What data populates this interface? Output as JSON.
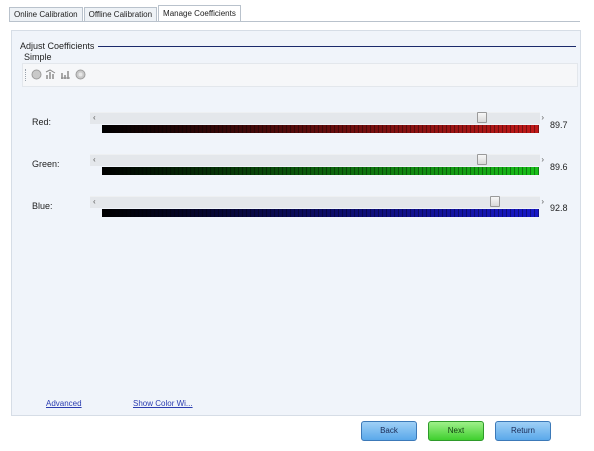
{
  "tabs": [
    {
      "label": "Online Calibration"
    },
    {
      "label": "Offline Calibration"
    },
    {
      "label": "Manage Coefficients"
    }
  ],
  "active_tab": "Manage Coefficients",
  "group": {
    "title": "Adjust Coefficients",
    "mode": "Simple"
  },
  "toolbar": {
    "icons": [
      "circle-icon",
      "chart-icon",
      "chart-alt-icon",
      "circle-alt-icon"
    ]
  },
  "channels": [
    {
      "label": "Red:",
      "value": "89.7",
      "level": 0.89
    },
    {
      "label": "Green:",
      "value": "89.6",
      "level": 0.89
    },
    {
      "label": "Blue:",
      "value": "92.8",
      "level": 0.92
    }
  ],
  "links": {
    "advanced": "Advanced",
    "show_color": "Show Color Wi..."
  },
  "buttons": {
    "back": "Back",
    "next": "Next",
    "return": "Return"
  },
  "colors": {
    "accent": "#1b2a6b",
    "red": "#c01818",
    "green": "#18c018",
    "blue": "#1818c8"
  }
}
